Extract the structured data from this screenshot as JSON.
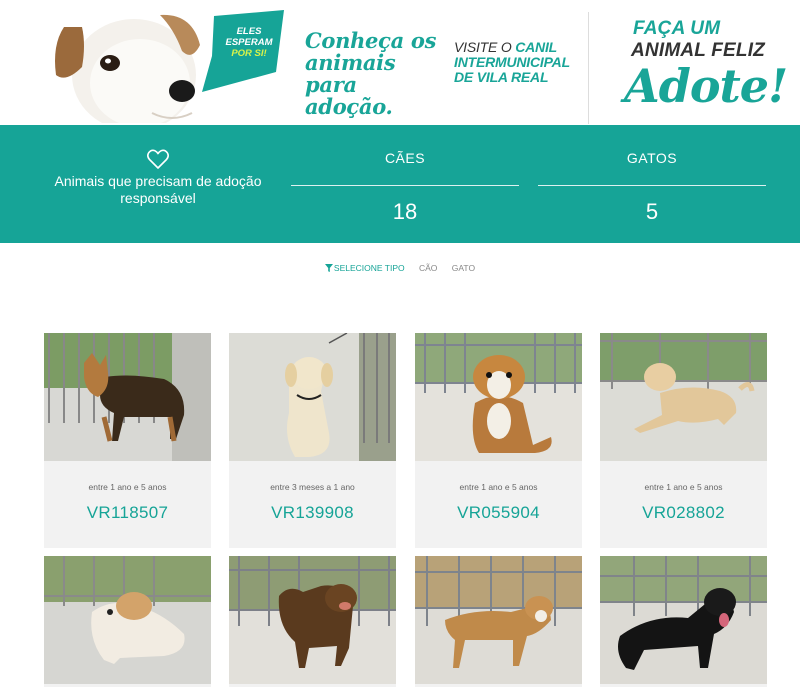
{
  "banner": {
    "tag_line1": "ELES",
    "tag_line2": "ESPERAM",
    "tag_line3": "POR SI!",
    "script_title": "Conheça os animais para adoção.",
    "visit_prefix": "VISITE O",
    "visit_accent": "CANIL INTERMUNICIPAL",
    "visit_suffix": "DE VILA REAL",
    "faca_line1": "FAÇA UM",
    "faca_line2": "ANIMAL FELIZ",
    "adote": "Adote!"
  },
  "stats": {
    "description": "Animais que precisam de adoção responsável",
    "dogs_label": "CÃES",
    "dogs_count": "18",
    "cats_label": "GATOS",
    "cats_count": "5"
  },
  "filter": {
    "select_type": "SELECIONE TIPO",
    "dog": "CÃO",
    "cat": "GATO"
  },
  "animals": [
    {
      "age": "entre 1 ano e 5 anos",
      "code": "VR118507"
    },
    {
      "age": "entre 3 meses a 1 ano",
      "code": "VR139908"
    },
    {
      "age": "entre 1 ano e 5 anos",
      "code": "VR055904"
    },
    {
      "age": "entre 1 ano e 5 anos",
      "code": "VR028802"
    },
    {
      "age": "",
      "code": ""
    },
    {
      "age": "",
      "code": ""
    },
    {
      "age": "",
      "code": ""
    },
    {
      "age": "",
      "code": ""
    }
  ],
  "colors": {
    "accent": "#16a497",
    "card_bg": "#f2f2f2"
  }
}
